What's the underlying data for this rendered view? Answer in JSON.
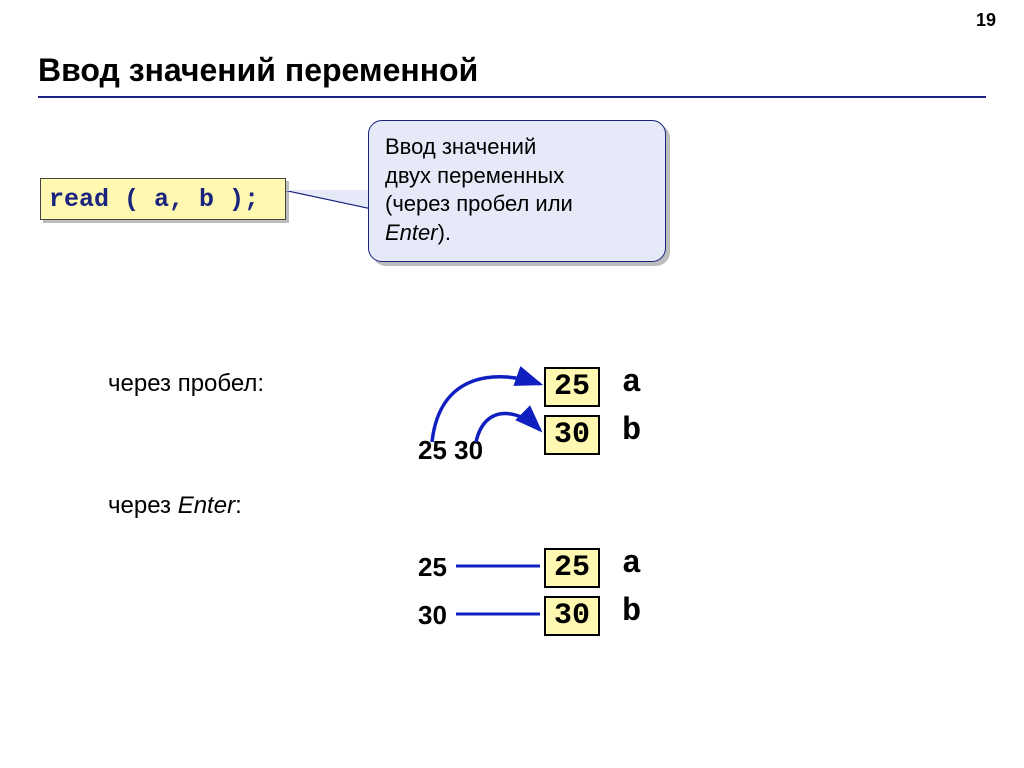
{
  "page_number": "19",
  "title": "Ввод значений переменной",
  "code": "read ( a, b );",
  "callout": {
    "line1": "Ввод значений",
    "line2": "двух переменных",
    "line3_pre": "(через пробел или",
    "line4_em": "Enter",
    "line4_post": ")."
  },
  "labels": {
    "space": "через пробел:",
    "enter_pre": "через ",
    "enter_em": "Enter",
    "enter_post": ":"
  },
  "example_space": {
    "input": "25 30",
    "val_a": "25",
    "val_b": "30",
    "name_a": "a",
    "name_b": "b"
  },
  "example_enter": {
    "input1": "25",
    "input2": "30",
    "val_a": "25",
    "val_b": "30",
    "name_a": "a",
    "name_b": "b"
  },
  "colors": {
    "rule": "#1a237e",
    "bubble_bg": "#e6e9f8",
    "code_bg": "#fff8b0",
    "arrow": "#1020c0"
  }
}
